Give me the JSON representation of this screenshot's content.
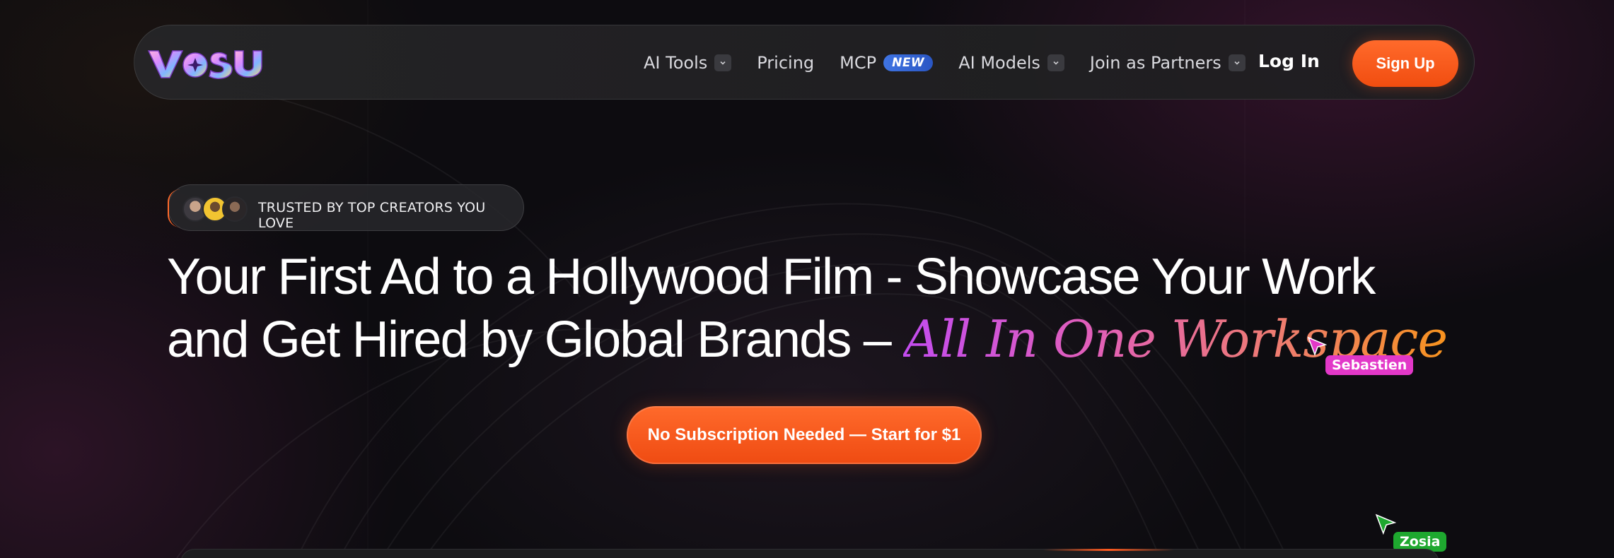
{
  "brand": {
    "logo_text": "VOSU"
  },
  "nav": {
    "items": [
      {
        "label": "AI Tools",
        "has_dropdown": true
      },
      {
        "label": "Pricing",
        "has_dropdown": false
      },
      {
        "label": "MCP",
        "badge": "NEW",
        "has_dropdown": false
      },
      {
        "label": "AI Models",
        "has_dropdown": true
      },
      {
        "label": "Join as Partners",
        "has_dropdown": true
      }
    ],
    "login_label": "Log In",
    "signup_label": "Sign Up"
  },
  "hero": {
    "trust_text": "TRUSTED BY TOP CREATORS YOU LOVE",
    "headline_line1": "Your First Ad to a Hollywood Film - Showcase Your Work",
    "headline_line2": "and Get Hired by Global Brands – ",
    "headline_accent": "All In One Workspace",
    "cta_label": "No Subscription Needed — Start for $1"
  },
  "cursors": [
    {
      "name": "Sebastien",
      "color": "#e238c8"
    },
    {
      "name": "Zosia",
      "color": "#1ea82f"
    }
  ],
  "colors": {
    "accent": "#f2541a",
    "badge_blue": "#3568d6",
    "background": "#0d0c10"
  }
}
